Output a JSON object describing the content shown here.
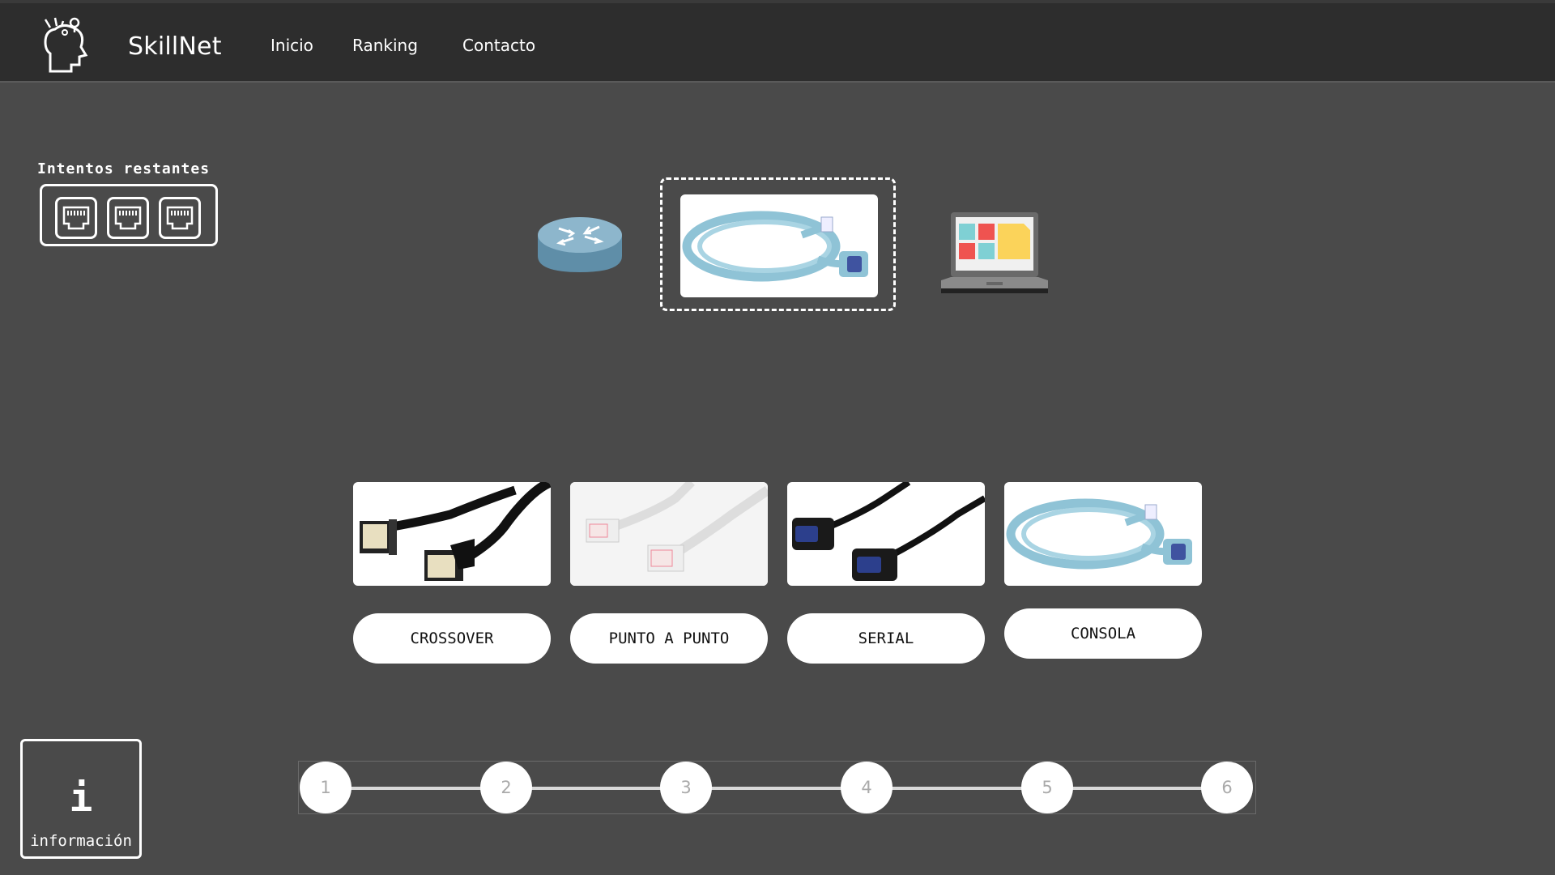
{
  "app": {
    "brand": "SkillNet"
  },
  "nav": {
    "items": [
      "Inicio",
      "Ranking",
      "Contacto"
    ]
  },
  "attempts": {
    "label": "Intentos restantes",
    "remaining": 3
  },
  "topology": {
    "left_device": "router-icon",
    "right_device": "laptop-icon",
    "selected_cable": "consola-cable-image"
  },
  "options": [
    {
      "label": "CROSSOVER",
      "image": "black-ethernet-cable-image"
    },
    {
      "label": "PUNTO A PUNTO",
      "image": "white-ethernet-cable-image"
    },
    {
      "label": "SERIAL",
      "image": "serial-cable-image"
    },
    {
      "label": "CONSOLA",
      "image": "console-cable-image"
    }
  ],
  "info": {
    "icon": "i",
    "label": "información"
  },
  "steps": [
    "1",
    "2",
    "3",
    "4",
    "5",
    "6"
  ],
  "colors": {
    "background": "#4a4a4a",
    "navbar": "#2d2d2d",
    "cable_blue": "#8fc3d6"
  }
}
